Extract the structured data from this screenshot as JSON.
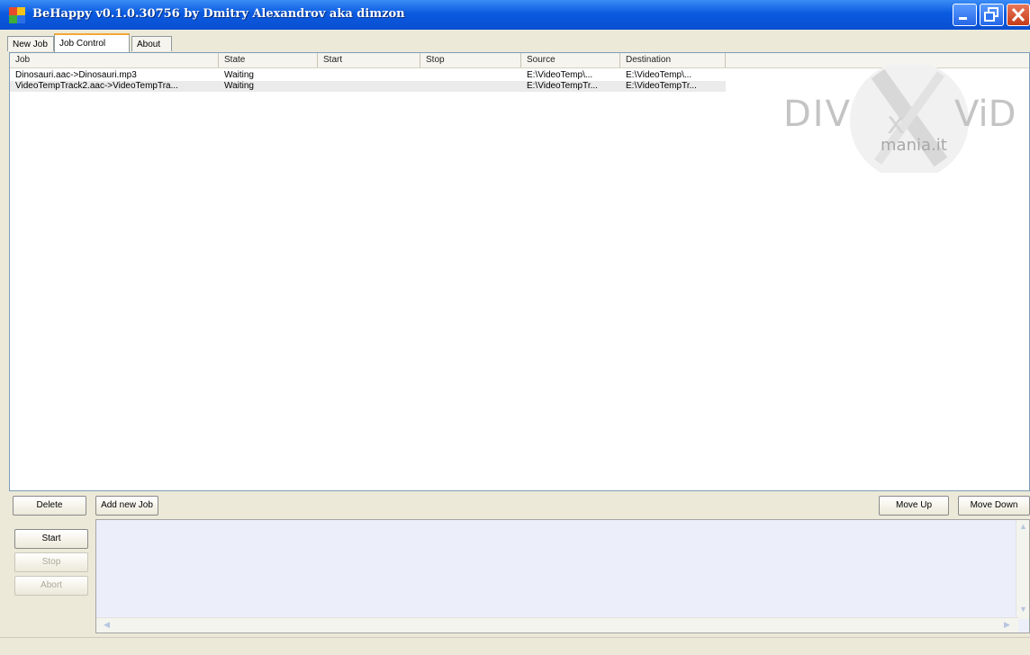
{
  "window": {
    "title": "BeHappy v0.1.0.30756 by Dmitry Alexandrov aka dimzon"
  },
  "tabs": [
    {
      "label": "New Job",
      "active": false
    },
    {
      "label": "Job Control",
      "active": true
    },
    {
      "label": "About",
      "active": false
    }
  ],
  "jobs_table": {
    "columns": [
      "Job",
      "State",
      "Start",
      "Stop",
      "Source",
      "Destination"
    ],
    "rows": [
      [
        "Dinosauri.aac->Dinosauri.mp3",
        "Waiting",
        "",
        "",
        "E:\\VideoTemp\\...",
        "E:\\VideoTemp\\..."
      ],
      [
        "VideoTempTrack2.aac->VideoTempTra...",
        "Waiting",
        "",
        "",
        "E:\\VideoTempTr...",
        "E:\\VideoTempTr..."
      ]
    ]
  },
  "watermark": {
    "brand": "DivXviD",
    "sub": "mania.it"
  },
  "buttons": {
    "delete": "Delete",
    "add_new_job": "Add new Job",
    "move_up": "Move Up",
    "move_down": "Move Down",
    "start": "Start",
    "stop": "Stop",
    "abort": "Abort"
  },
  "icons": {
    "minimize": "minimize-icon",
    "maximize": "maximize-icon",
    "close": "close-icon",
    "app": "app-icon"
  },
  "colors": {
    "titlebar": "#0a5ae0",
    "close_button": "#c53b18",
    "active_tab_accent": "#f5a733",
    "log_background": "#eceffa"
  }
}
